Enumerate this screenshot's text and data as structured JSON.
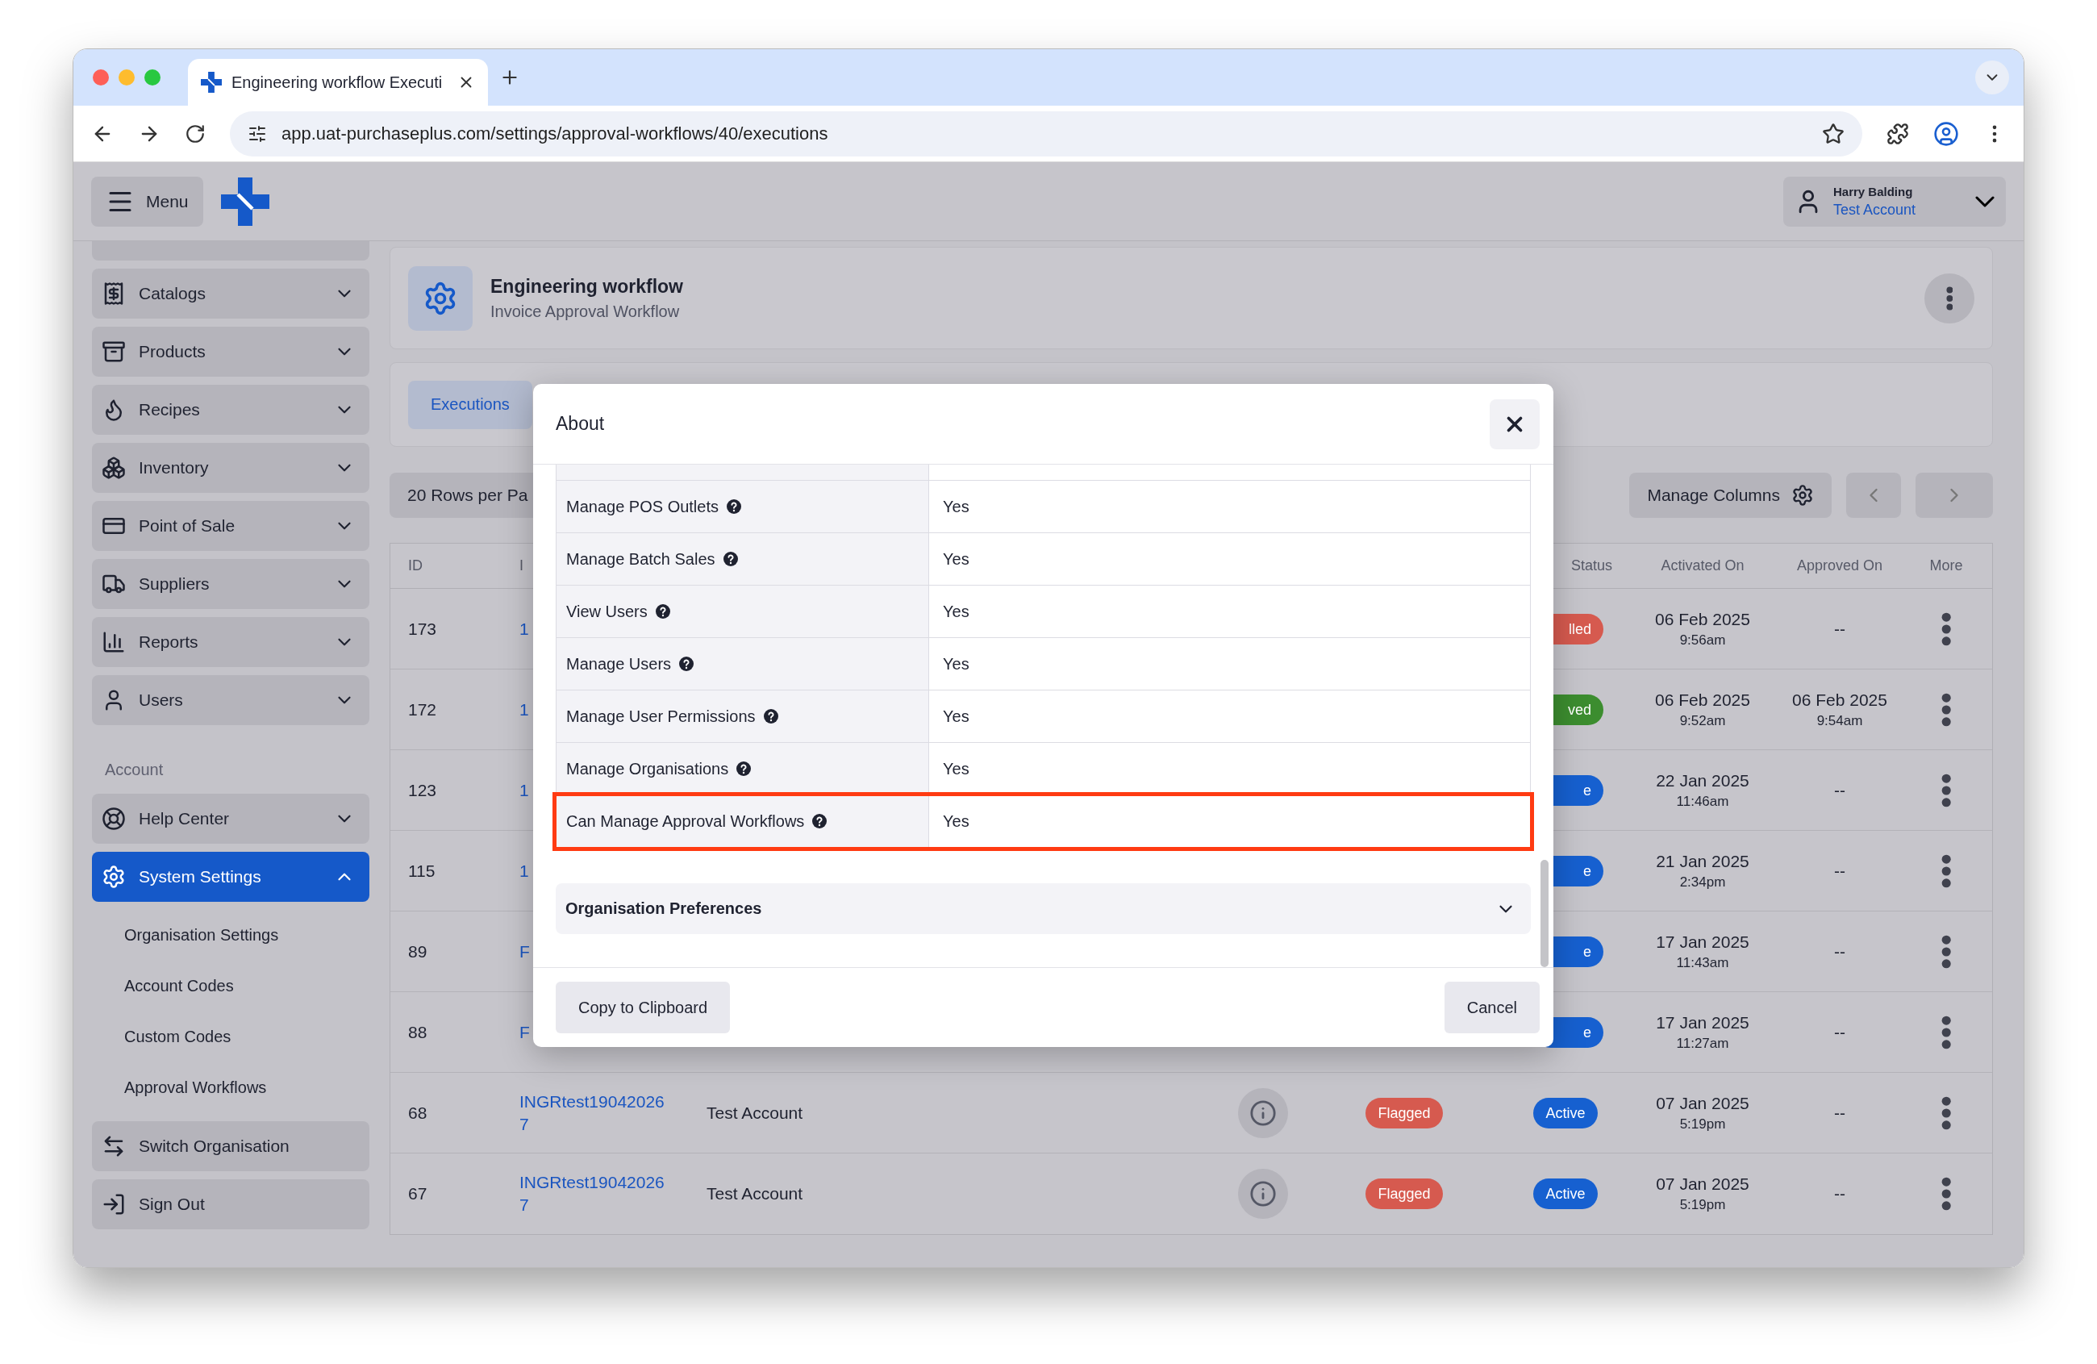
{
  "browser": {
    "tab_title": "Engineering workflow Executi",
    "url": "app.uat-purchaseplus.com/settings/approval-workflows/40/executions"
  },
  "header": {
    "menu_label": "Menu",
    "user_name": "Harry Balding",
    "account": "Test Account"
  },
  "sidebar": {
    "items": [
      {
        "label": "Catalogs",
        "expanded": false
      },
      {
        "label": "Products",
        "expanded": false
      },
      {
        "label": "Recipes",
        "expanded": false
      },
      {
        "label": "Inventory",
        "expanded": false
      },
      {
        "label": "Point of Sale",
        "expanded": false
      },
      {
        "label": "Suppliers",
        "expanded": false
      },
      {
        "label": "Reports",
        "expanded": false
      },
      {
        "label": "Users",
        "expanded": false
      }
    ],
    "section_label": "Account",
    "account_items": [
      {
        "kind": "menu",
        "label": "Help Center",
        "selected": false,
        "expanded": false
      },
      {
        "kind": "menu",
        "label": "System Settings",
        "selected": true,
        "expanded": true,
        "children": [
          {
            "label": "Organisation Settings"
          },
          {
            "label": "Account Codes"
          },
          {
            "label": "Custom Codes"
          },
          {
            "label": "Approval Workflows"
          }
        ]
      },
      {
        "kind": "action",
        "label": "Switch Organisation"
      },
      {
        "kind": "action",
        "label": "Sign Out"
      }
    ]
  },
  "workflow": {
    "title": "Engineering workflow",
    "subtitle": "Invoice Approval Workflow"
  },
  "tabs": [
    {
      "label": "Executions",
      "selected": true
    }
  ],
  "toolbar": {
    "page_size": "20 Rows per Pa",
    "manage_columns": "Manage Columns"
  },
  "table": {
    "columns": [
      "ID",
      "I",
      "Status",
      "Activated On",
      "Approved On",
      "More"
    ],
    "rows": [
      {
        "id": "173",
        "reference": "1",
        "status": {
          "text": "lled",
          "color": "#d65a4f"
        },
        "activated": {
          "date": "06 Feb 2025",
          "time": "9:56am"
        },
        "approved": {
          "date": "--"
        }
      },
      {
        "id": "172",
        "reference": "1",
        "status": {
          "text": "ved",
          "color": "#3c8d2f"
        },
        "activated": {
          "date": "06 Feb 2025",
          "time": "9:52am"
        },
        "approved": {
          "date": "06 Feb 2025",
          "time": "9:54am"
        }
      },
      {
        "id": "123",
        "reference": "1",
        "status": {
          "text": "e",
          "color": "#1660d0"
        },
        "activated": {
          "date": "22 Jan 2025",
          "time": "11:46am"
        },
        "approved": {
          "date": "--"
        }
      },
      {
        "id": "115",
        "reference": "1",
        "status": {
          "text": "e",
          "color": "#1660d0"
        },
        "activated": {
          "date": "21 Jan 2025",
          "time": "2:34pm"
        },
        "approved": {
          "date": "--"
        }
      },
      {
        "id": "89",
        "reference": "F",
        "status": {
          "text": "e",
          "color": "#1660d0"
        },
        "activated": {
          "date": "17 Jan 2025",
          "time": "11:43am"
        },
        "approved": {
          "date": "--"
        }
      },
      {
        "id": "88",
        "reference": "F",
        "status": {
          "text": "e",
          "color": "#1660d0"
        },
        "activated": {
          "date": "17 Jan 2025",
          "time": "11:27am"
        },
        "approved": {
          "date": "--"
        }
      },
      {
        "id": "68",
        "reference": "INGRtest190420267",
        "account": "Test Account",
        "info_button": true,
        "flag": {
          "text": "Flagged",
          "color": "#d65a4f"
        },
        "status": {
          "text": "Active",
          "color": "#1660d0"
        },
        "activated": {
          "date": "07 Jan 2025",
          "time": "5:19pm"
        },
        "approved": {
          "date": "--"
        }
      },
      {
        "id": "67",
        "reference": "INGRtest190420267",
        "account": "Test Account",
        "info_button": true,
        "flag": {
          "text": "Flagged",
          "color": "#d65a4f"
        },
        "status": {
          "text": "Active",
          "color": "#1660d0"
        },
        "activated": {
          "date": "07 Jan 2025",
          "time": "5:19pm"
        },
        "approved": {
          "date": "--"
        }
      }
    ]
  },
  "modal": {
    "title": "About",
    "permissions": [
      {
        "label": "Manage POS Outlets",
        "value": "Yes",
        "highlighted": false
      },
      {
        "label": "Manage Batch Sales",
        "value": "Yes",
        "highlighted": false
      },
      {
        "label": "View Users",
        "value": "Yes",
        "highlighted": false
      },
      {
        "label": "Manage Users",
        "value": "Yes",
        "highlighted": false
      },
      {
        "label": "Manage User Permissions",
        "value": "Yes",
        "highlighted": false
      },
      {
        "label": "Manage Organisations",
        "value": "Yes",
        "highlighted": false
      },
      {
        "label": "Can Manage Approval Workflows",
        "value": "Yes",
        "highlighted": true
      }
    ],
    "sections": [
      {
        "label": "Organisation Preferences",
        "expanded": false
      }
    ],
    "buttons": [
      "Copy to Clipboard",
      "Cancel"
    ]
  }
}
